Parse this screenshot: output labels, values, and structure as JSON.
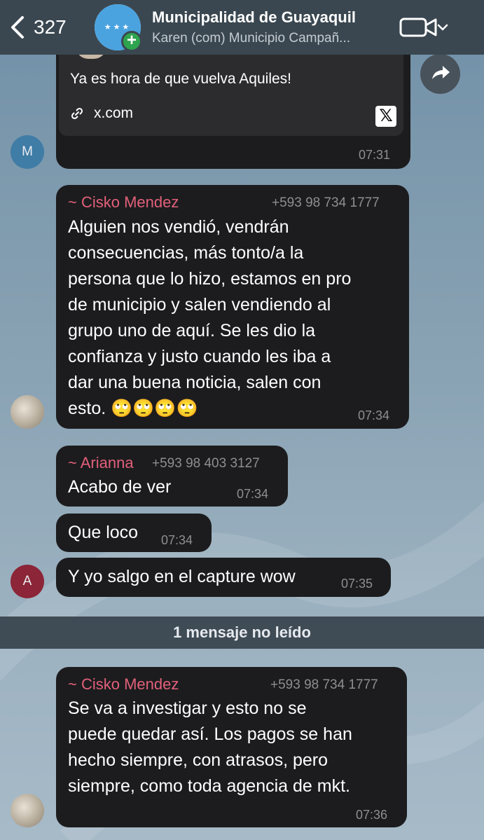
{
  "header": {
    "back_count": "327",
    "title": "Municipalidad de Guayaquil",
    "subtitle": "Karen (com) Municipio Campañ..."
  },
  "messages": [
    {
      "text": "Ya es hora de que vuelva Aquiles!",
      "link": "x.com",
      "time": "07:31",
      "avatar_letter": "M"
    },
    {
      "sender": "~ Cisko Mendez",
      "phone": "+593 98 734 1777",
      "lines": [
        "Alguien nos vendió, vendrán",
        "consecuencias, más tonto/a la",
        "persona que lo hizo, estamos en pro",
        "de municipio y salen vendiendo al",
        "grupo uno de aquí. Se les dio la",
        "confianza y justo cuando les iba a",
        "dar una buena noticia, salen con",
        "esto. 🙄🙄🙄🙄"
      ],
      "time": "07:34"
    },
    {
      "sender": "~ Arianna",
      "phone": "+593 98 403 3127",
      "text": "Acabo de ver",
      "time": "07:34"
    },
    {
      "text": "Que loco",
      "time": "07:34"
    },
    {
      "text": "Y yo salgo en el capture wow",
      "time": "07:35",
      "avatar_letter": "A"
    },
    {
      "sender": "~ Cisko Mendez",
      "phone": "+593 98 734 1777",
      "lines": [
        "Se va a investigar y esto no se",
        "puede quedar así. Los pagos se han",
        "hecho siempre, con atrasos, pero",
        "siempre, como toda agencia de mkt."
      ],
      "time": "07:36"
    }
  ],
  "unread_label": "1 mensaje no leído",
  "colors": {
    "header_bg": "#3a4750",
    "bubble_bg": "#1c1c1e",
    "sender_name": "#e2607a",
    "meta_gray": "#8e8e93",
    "avatar_m": "#3f7ca6",
    "avatar_a": "#8b2537",
    "unread_bar": "#3f4b55"
  },
  "icons": {
    "back": "chevron-left-icon",
    "video": "video-camera-icon",
    "chevron": "chevron-down-icon",
    "forward": "forward-arrow-icon",
    "link": "link-icon",
    "x_logo": "x-logo-icon",
    "add": "plus-icon"
  }
}
